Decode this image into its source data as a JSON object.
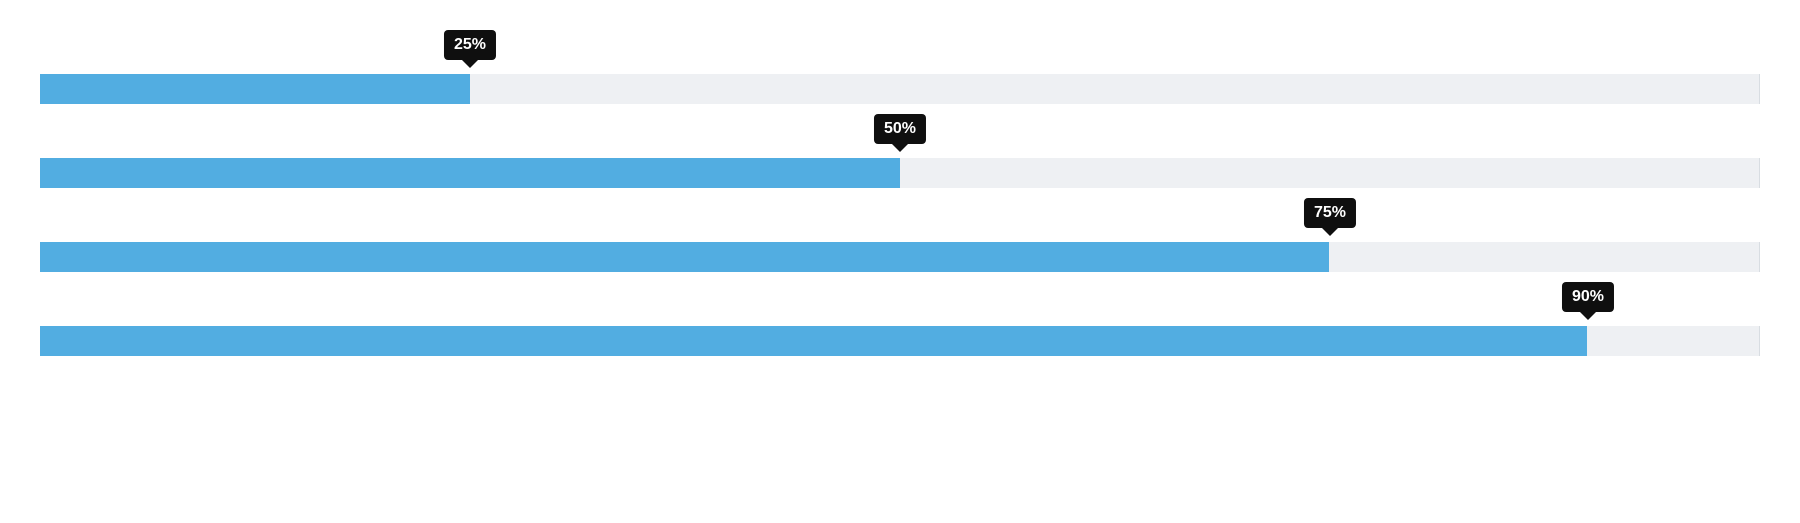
{
  "chart_data": {
    "type": "bar",
    "orientation": "horizontal",
    "series": [
      {
        "value": 25,
        "label": "25%"
      },
      {
        "value": 50,
        "label": "50%"
      },
      {
        "value": 75,
        "label": "75%"
      },
      {
        "value": 90,
        "label": "90%"
      }
    ],
    "xlim": [
      0,
      100
    ],
    "fill_color": "#52ADE1",
    "track_color": "#EEF0F3",
    "tooltip_color": "#0f0f0f"
  }
}
